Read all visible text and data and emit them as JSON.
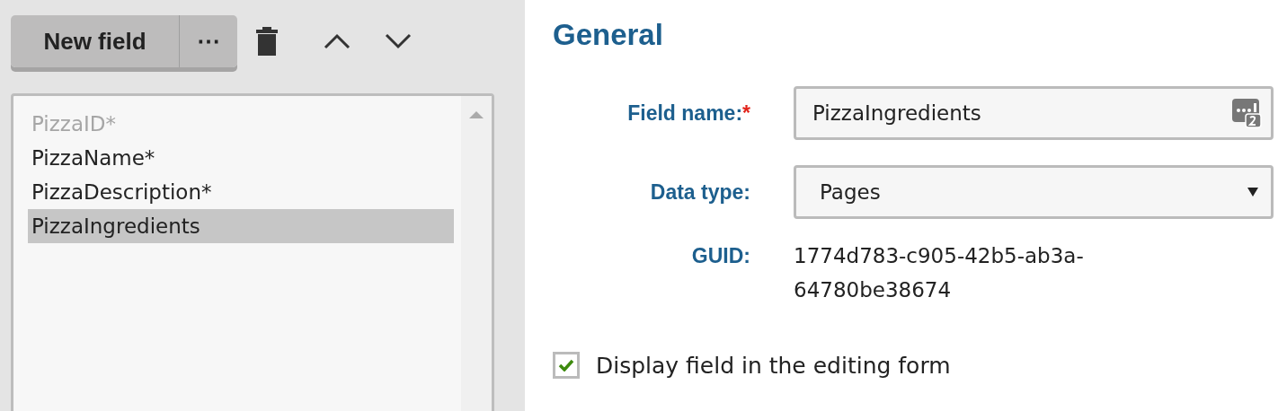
{
  "toolbar": {
    "new_button": "New field",
    "more_button": "⋯"
  },
  "fields_list": [
    {
      "label": "PizzaID*",
      "disabled": true,
      "selected": false
    },
    {
      "label": "PizzaName*",
      "disabled": false,
      "selected": false
    },
    {
      "label": "PizzaDescription*",
      "disabled": false,
      "selected": false
    },
    {
      "label": "PizzaIngredients",
      "disabled": false,
      "selected": true
    }
  ],
  "section_title": "General",
  "form": {
    "field_name": {
      "label": "Field name:",
      "required_mark": "*",
      "value": "PizzaIngredients"
    },
    "data_type": {
      "label": "Data type:",
      "value": "Pages"
    },
    "guid": {
      "label": "GUID:",
      "value_lines": [
        "1774d783-c905-42b5-ab3a-",
        "64780be38674"
      ]
    },
    "display_checkbox": {
      "label": "Display field in the editing form",
      "checked": true
    }
  }
}
